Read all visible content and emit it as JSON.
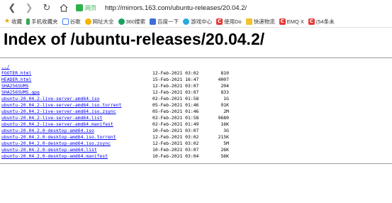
{
  "browser": {
    "security_label": "网页",
    "url": "http://mirrors.163.com/ubuntu-releases/20.04.2/",
    "bookmarks": [
      {
        "label": "收藏",
        "icon": "star-icon"
      },
      {
        "label": "手机收藏夹",
        "icon": "phone-icon"
      },
      {
        "label": "谷歌",
        "icon": "google-icon"
      },
      {
        "label": "网址大全",
        "icon": "globe-icon"
      },
      {
        "label": "360搜索",
        "icon": "search-icon"
      },
      {
        "label": "百度一下",
        "icon": "baidu-icon"
      },
      {
        "label": "游戏中心",
        "icon": "gamepad-icon"
      },
      {
        "label": "使用Do",
        "icon": "c-icon"
      },
      {
        "label": "快递物流",
        "icon": "folder-icon"
      },
      {
        "label": "EMQ X",
        "icon": "c-icon"
      },
      {
        "label": "(54条未",
        "icon": "c-icon"
      }
    ]
  },
  "page": {
    "title": "Index of /ubuntu-releases/20.04.2/",
    "parent": "../",
    "files": [
      {
        "name": "FOOTER.html",
        "date": "12-Feb-2021 03:02",
        "size": "810"
      },
      {
        "name": "HEADER.html",
        "date": "15-Feb-2021 16:47",
        "size": "4007"
      },
      {
        "name": "SHA256SUMS",
        "date": "12-Feb-2021 03:07",
        "size": "204"
      },
      {
        "name": "SHA256SUMS.gpg",
        "date": "12-Feb-2021 03:07",
        "size": "833"
      },
      {
        "name": "ubuntu-20.04.2-live-server-amd64.iso",
        "date": "02-Feb-2021 01:58",
        "size": "1G"
      },
      {
        "name": "ubuntu-20.04.2-live-server-amd64.iso.torrent",
        "date": "05-Feb-2021 01:46",
        "size": "91K"
      },
      {
        "name": "ubuntu-20.04.2-live-server-amd64.iso.zsync",
        "date": "05-Feb-2021 01:46",
        "size": "2M"
      },
      {
        "name": "ubuntu-20.04.2-live-server-amd64.list",
        "date": "02-Feb-2021 01:58",
        "size": "9680"
      },
      {
        "name": "ubuntu-20.04.2-live-server-amd64.manifest",
        "date": "02-Feb-2021 01:49",
        "size": "16K"
      },
      {
        "name": "ubuntu-20.04.2.0-desktop-amd64.iso",
        "date": "10-Feb-2021 03:07",
        "size": "3G"
      },
      {
        "name": "ubuntu-20.04.2.0-desktop-amd64.iso.torrent",
        "date": "12-Feb-2021 03:02",
        "size": "215K"
      },
      {
        "name": "ubuntu-20.04.2.0-desktop-amd64.iso.zsync",
        "date": "12-Feb-2021 03:02",
        "size": "5M"
      },
      {
        "name": "ubuntu-20.04.2.0-desktop-amd64.list",
        "date": "10-Feb-2021 03:07",
        "size": "26K"
      },
      {
        "name": "ubuntu-20.04.2.0-desktop-amd64.manifest",
        "date": "10-Feb-2021 03:04",
        "size": "56K"
      }
    ]
  },
  "colors": {
    "link": "#0000ee",
    "secure": "#2db24a"
  }
}
